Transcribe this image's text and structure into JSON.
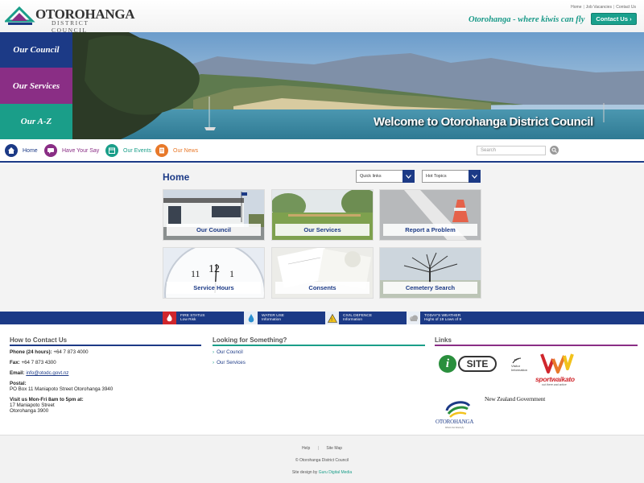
{
  "header": {
    "logo_name": "OTOROHANGA",
    "logo_sub": "DISTRICT COUNCIL",
    "top_links": [
      "Home",
      "Job Vacancies",
      "Contact Us"
    ],
    "tagline": "Otorohanga - where kiwis can fly",
    "contact_button": "Contact Us ›"
  },
  "banner": {
    "tabs": [
      "Our Council",
      "Our Services",
      "Our A-Z"
    ],
    "welcome": "Welcome to Otorohanga District Council"
  },
  "nav": {
    "items": [
      {
        "label": "Home",
        "color": "#1c3a86"
      },
      {
        "label": "Have Your Say",
        "color": "#8a2e85"
      },
      {
        "label": "Our Events",
        "color": "#1a9e89"
      },
      {
        "label": "Our News",
        "color": "#e8792a"
      }
    ],
    "search_placeholder": "Search"
  },
  "main": {
    "title": "Home",
    "quick_links": "Quick links",
    "hot_topics": "Hot Topics",
    "tiles": [
      "Our Council",
      "Our Services",
      "Report a Problem",
      "Service Hours",
      "Consents",
      "Cemetery Search"
    ]
  },
  "strip": [
    {
      "title": "FIRE STATUS",
      "sub": "Low Risk"
    },
    {
      "title": "WATER USE",
      "sub": "Information"
    },
    {
      "title": "CIVIL DEFENCE",
      "sub": "Information"
    },
    {
      "title": "TODAY'S WEATHER",
      "sub": "Highs of 19 Lows of 8"
    }
  ],
  "contact": {
    "title": "How to Contact Us",
    "phone_label": "Phone (24 hours):",
    "phone": "+64 7 873 4000",
    "fax_label": "Fax:",
    "fax": "+64 7 873 4300",
    "email_label": "Email:",
    "email": "info@otodc.govt.nz",
    "postal_label": "Postal:",
    "postal": "PO Box 11 Maniapoto Street Otorohanga 3940",
    "visit_label": "Visit us Mon-Fri 8am to 5pm at:",
    "visit_line1": "17 Maniapoto Street",
    "visit_line2": "Otorohanga 3900"
  },
  "looking": {
    "title": "Looking for Something?",
    "links": [
      "Our Council",
      "Our Services"
    ]
  },
  "links": {
    "title": "Links",
    "isite": "SITE",
    "visitor_info": "Visitor Information",
    "sportwaikato": "sportwaikato",
    "sport_tag": "out there and active",
    "nzgov": "New Zealand Government",
    "oto_logo": "OTOROHANGA",
    "oto_tag": "Where the Kiwis fly"
  },
  "footer": {
    "help": "Help",
    "sitemap": "Site Map",
    "copyright": "© Otorohanga District Council",
    "design_prefix": "Site design by",
    "design_by": "Guru Digital Media"
  }
}
